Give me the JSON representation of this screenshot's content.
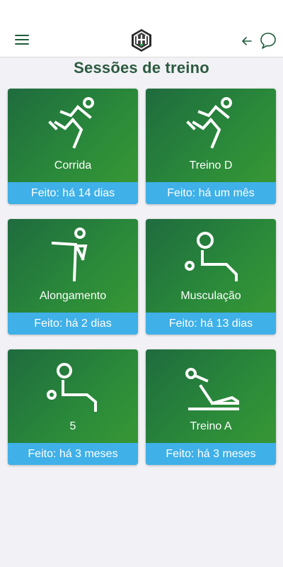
{
  "header": {
    "menu_icon": "hamburger-menu-icon",
    "logo_icon": "app-logo-icon",
    "back_icon": "arrow-left-icon",
    "chat_icon": "chat-bubble-icon",
    "accent_color": "#1f5c3a"
  },
  "page": {
    "title": "Sessões de treino"
  },
  "sessions": [
    {
      "name": "Corrida",
      "status": "Feito: há 14 dias",
      "icon": "running-icon"
    },
    {
      "name": "Treino D",
      "status": "Feito: há um mês",
      "icon": "running-icon"
    },
    {
      "name": "Alongamento",
      "status": "Feito: há 2 dias",
      "icon": "stretching-icon"
    },
    {
      "name": "Musculação",
      "status": "Feito: há 13 dias",
      "icon": "weightlifting-icon"
    },
    {
      "name": "5",
      "status": "Feito: há 3 meses",
      "icon": "weightlifting-icon"
    },
    {
      "name": "Treino A",
      "status": "Feito: há 3 meses",
      "icon": "situp-icon"
    }
  ],
  "colors": {
    "card_gradient_start": "#1f6b3e",
    "card_gradient_end": "#3a9a33",
    "status_bar": "#3fb0e8"
  }
}
